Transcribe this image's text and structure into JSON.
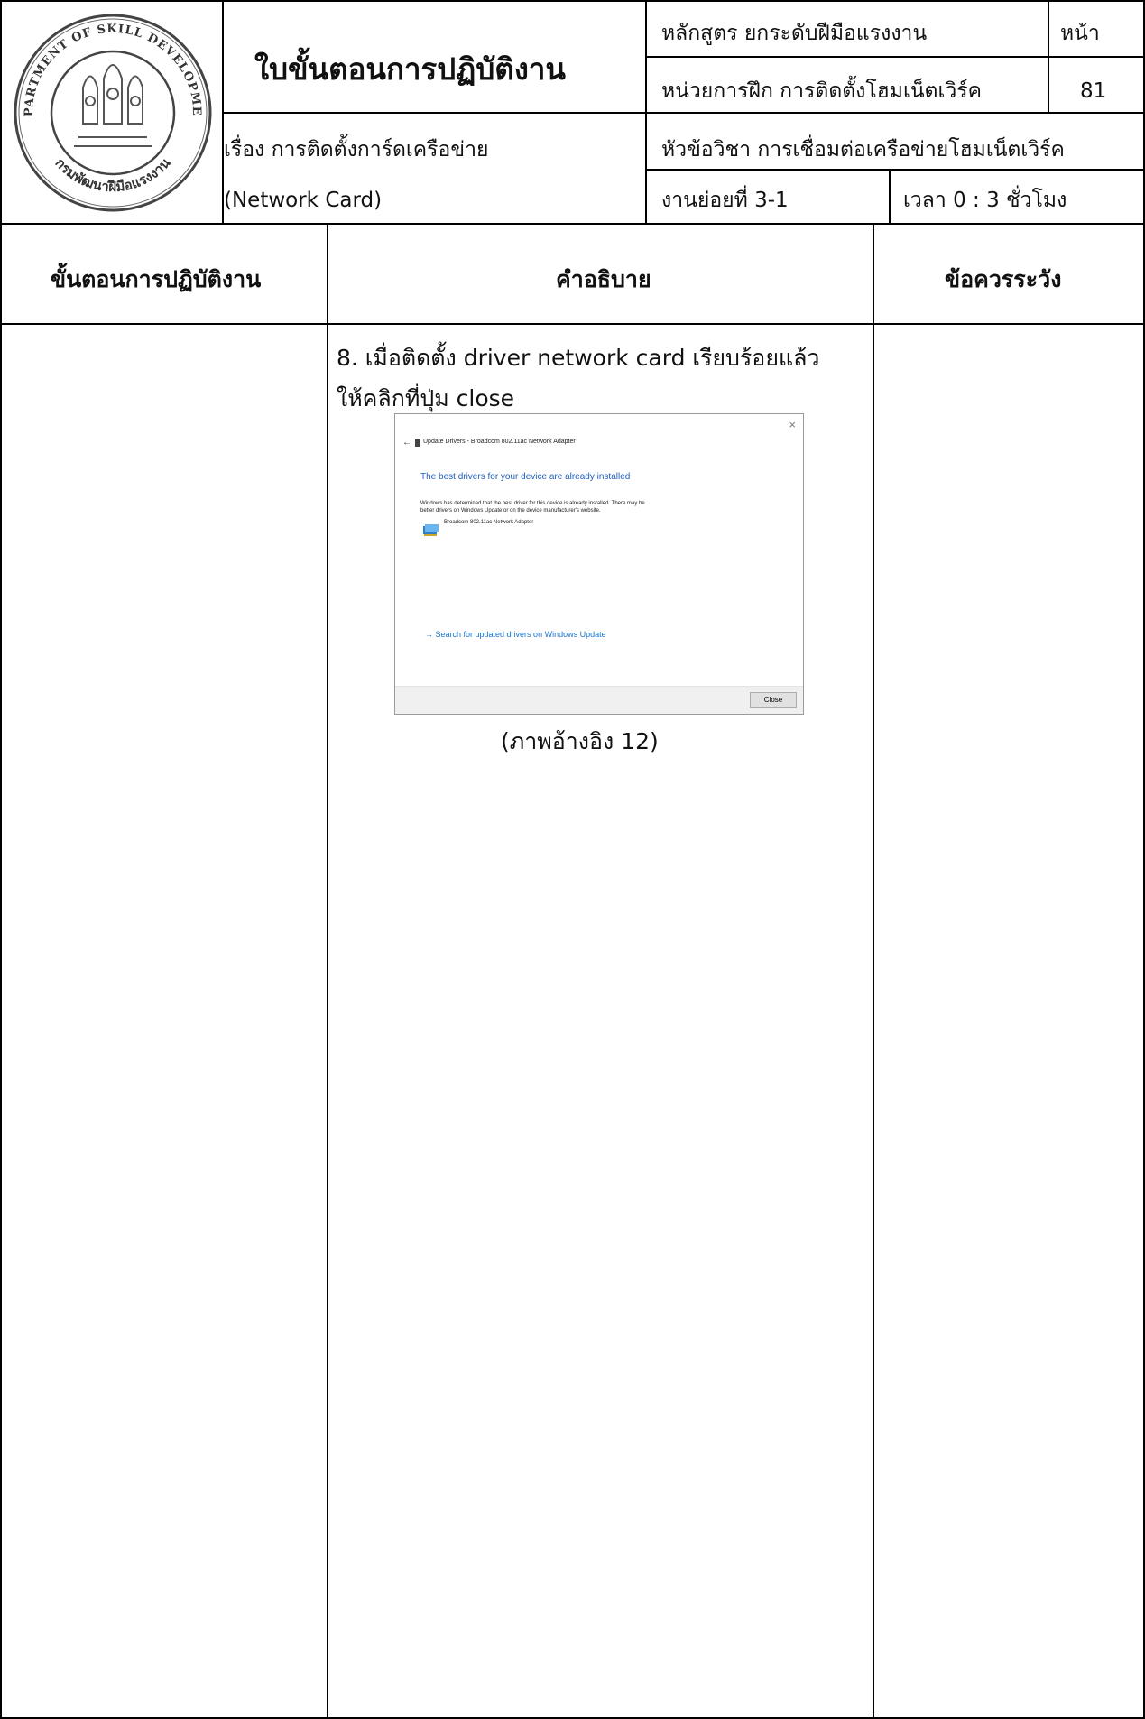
{
  "header": {
    "emblem_text_top": "DEPARTMENT OF SKILL DEVELOPMENT",
    "emblem_text_bottom": "กรมพัฒนาฝีมือแรงงาน",
    "title": "ใบขั้นตอนการปฏิบัติงาน",
    "course": "หลักสูตร ยกระดับฝีมือแรงงาน",
    "page_label": "หน้า",
    "unit": "หน่วยการฝึก การติดตั้งโฮมเน็ตเวิร์ค",
    "page_number": "81",
    "topic_line1": "เรื่อง การติดตั้งการ์ดเครือข่าย",
    "topic_line2": "(Network Card)",
    "subject": "หัวข้อวิชา การเชื่อมต่อเครือข่ายโฮมเน็ตเวิร์ค",
    "subtask": "งานย่อยที่   3-1",
    "time": "เวลา 0  : 3 ชั่วโมง"
  },
  "columns": {
    "steps": "ขั้นตอนการปฏิบัติงาน",
    "description": "คำอธิบาย",
    "caution": "ข้อควรระวัง"
  },
  "content": {
    "step_line1": "8. เมื่อติดตั้ง driver network card เรียบร้อยแล้ว",
    "step_line2": "ให้คลิกที่ปุ่ม close",
    "caption": "(ภาพอ้างอิง 12)"
  },
  "dialog": {
    "close_x": "×",
    "back_arrow": "←",
    "title": "Update Drivers - Broadcom 802.11ac Network Adapter",
    "heading": "The best drivers for your device are already installed",
    "body_line1": "Windows has determined that the best driver for this device is already installed. There may be",
    "body_line2": "better drivers on Windows Update or on the device manufacturer's website.",
    "device_name": "Broadcom 802.11ac Network Adapter",
    "link": "→  Search for updated drivers on Windows Update",
    "close_button": "Close",
    "heading_color": "#1e5fbf",
    "link_color": "#1a73c9"
  }
}
